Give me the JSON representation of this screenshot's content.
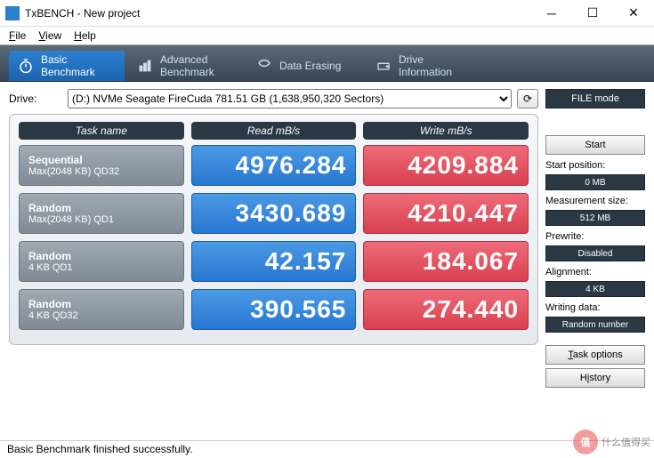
{
  "window": {
    "title": "TxBENCH - New project"
  },
  "menu": {
    "file": "File",
    "view": "View",
    "help": "Help"
  },
  "tabs": {
    "basic": "Basic\nBenchmark",
    "advanced": "Advanced\nBenchmark",
    "erasing": "Data Erasing",
    "drive": "Drive\nInformation"
  },
  "drive": {
    "label": "Drive:",
    "selected": "(D:) NVMe Seagate FireCuda  781.51 GB (1,638,950,320 Sectors)"
  },
  "headers": {
    "task": "Task name",
    "read": "Read mB/s",
    "write": "Write mB/s"
  },
  "rows": [
    {
      "name1": "Sequential",
      "name2": "Max(2048 KB) QD32",
      "read": "4976.284",
      "write": "4209.884"
    },
    {
      "name1": "Random",
      "name2": "Max(2048 KB) QD1",
      "read": "3430.689",
      "write": "4210.447"
    },
    {
      "name1": "Random",
      "name2": "4 KB QD1",
      "read": "42.157",
      "write": "184.067"
    },
    {
      "name1": "Random",
      "name2": "4 KB QD32",
      "read": "390.565",
      "write": "274.440"
    }
  ],
  "side": {
    "filemode": "FILE mode",
    "start": "Start",
    "startpos_label": "Start position:",
    "startpos_value": "0 MB",
    "msize_label": "Measurement size:",
    "msize_value": "512 MB",
    "prewrite_label": "Prewrite:",
    "prewrite_value": "Disabled",
    "align_label": "Alignment:",
    "align_value": "4 KB",
    "wdata_label": "Writing data:",
    "wdata_value": "Random number",
    "taskopt": "Task options",
    "history": "History"
  },
  "status": "Basic Benchmark finished successfully.",
  "watermark": "值 | 什么值得买"
}
